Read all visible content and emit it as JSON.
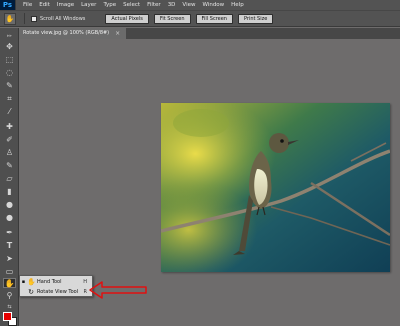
{
  "app": {
    "logo": "Ps"
  },
  "menu": [
    "File",
    "Edit",
    "Image",
    "Layer",
    "Type",
    "Select",
    "Filter",
    "3D",
    "View",
    "Window",
    "Help"
  ],
  "options": {
    "scroll_all_label": "Scroll All Windows",
    "scroll_all_checked": false,
    "buttons": [
      "Actual Pixels",
      "Fit Screen",
      "Fill Screen",
      "Print Size"
    ]
  },
  "document": {
    "tab_title": "Rotate view.jpg @ 100% (RGB/8#)",
    "close_glyph": "×"
  },
  "flyout": {
    "items": [
      {
        "label": "Hand Tool",
        "shortcut": "H",
        "active": true
      },
      {
        "label": "Rotate View Tool",
        "shortcut": "R",
        "active": false
      }
    ]
  },
  "colors": {
    "foreground": "#e60000",
    "background": "#ffffff",
    "annotation_arrow": "#e01010"
  }
}
